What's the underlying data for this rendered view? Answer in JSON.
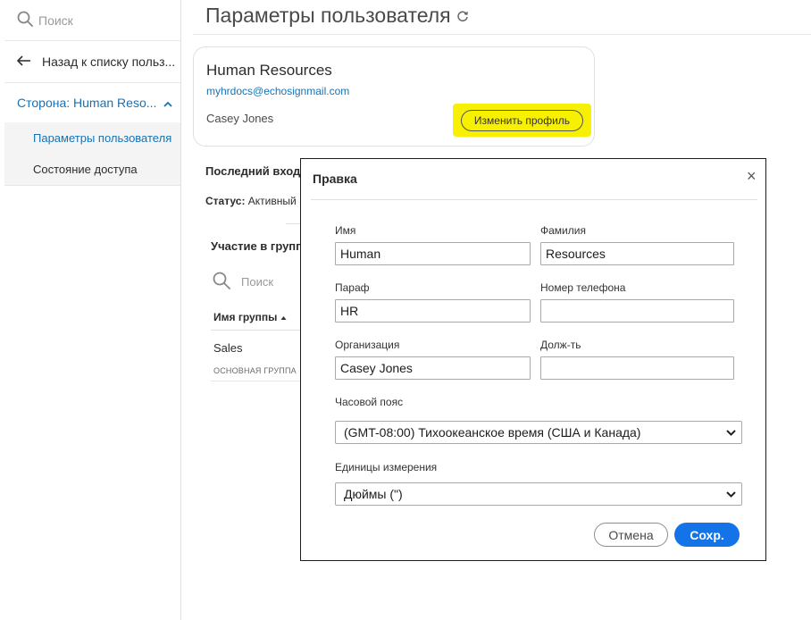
{
  "sidebar": {
    "search_placeholder": "Поиск",
    "back_label": "Назад к списку польз...",
    "party_label": "Сторона: Human Reso...",
    "items": [
      {
        "label": "Параметры пользователя"
      },
      {
        "label": "Состояние доступа"
      }
    ]
  },
  "main": {
    "title": "Параметры пользователя",
    "profile": {
      "name": "Human Resources",
      "email": "myhrdocs@echosignmail.com",
      "person": "Casey Jones",
      "edit_button": "Изменить профиль"
    },
    "last_login_label": "Последний вход:",
    "status_label": "Статус:",
    "status_value": "Активный",
    "groups": {
      "title": "Участие в групп",
      "search_placeholder": "Поиск",
      "column_header": "Имя группы",
      "rows": [
        {
          "name": "Sales",
          "tag": "ОСНОВНАЯ ГРУППА"
        }
      ]
    }
  },
  "modal": {
    "title": "Правка",
    "close": "×",
    "fields": {
      "first_name": {
        "label": "Имя",
        "value": "Human"
      },
      "last_name": {
        "label": "Фамилия",
        "value": "Resources"
      },
      "initials": {
        "label": "Параф",
        "value": "HR"
      },
      "phone": {
        "label": "Номер телефона",
        "value": ""
      },
      "organization": {
        "label": "Организация",
        "value": "Casey Jones"
      },
      "position": {
        "label": "Долж-ть",
        "value": ""
      },
      "timezone": {
        "label": "Часовой пояс",
        "value": "(GMT-08:00) Тихоокеанское время (США и Канада)"
      },
      "units": {
        "label": "Единицы измерения",
        "value": "Дюймы (\")"
      }
    },
    "cancel_button": "Отмена",
    "save_button": "Сохр."
  },
  "colors": {
    "accent_blue": "#1473b8",
    "primary_button": "#1473e6",
    "highlight": "#f7f000"
  }
}
